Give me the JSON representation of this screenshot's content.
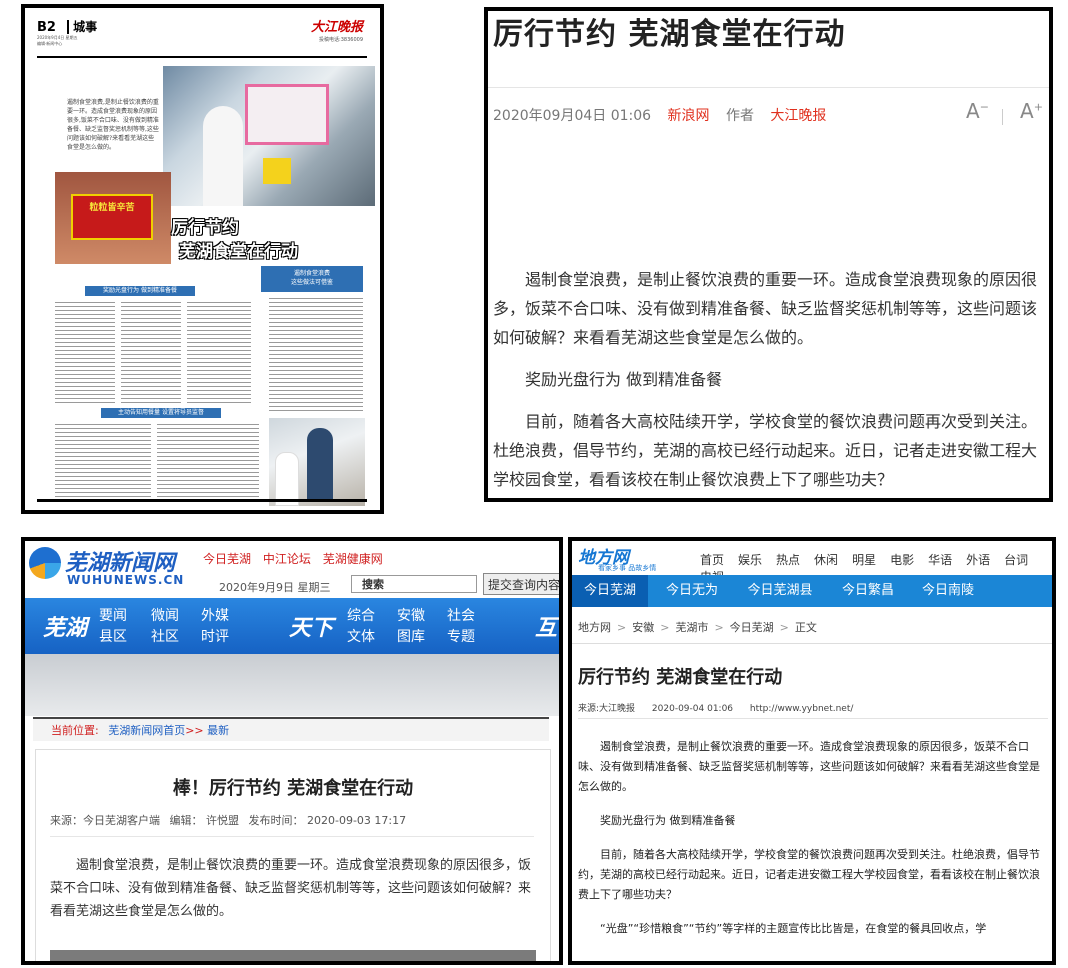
{
  "panel1": {
    "page_no": "B2",
    "section": "城事",
    "header_small": [
      "2020年9月4日  星期五",
      "编辑·新闻中心"
    ],
    "logo": "大江晚报",
    "hotline": "投稿电话:3836009",
    "intro": "遏制食堂浪费,是制止餐饮浪费的重要一环。造成食堂浪费现象的原因很多,饭菜不合口味、没有做到精准备餐、缺乏监督奖惩机制等等,这些问题该如何破解?来看看芜湖这些食堂是怎么做的。",
    "plate_text": "粒粒皆辛苦",
    "big_title": [
      "厉行节约",
      "芜湖食堂在行动"
    ],
    "side_box": [
      "遏制食堂浪费",
      "这些做法可借鉴"
    ],
    "sub1": "奖励光盘行为 做到精准备餐",
    "sub2": "主动告知用餐量 设置将导员监督"
  },
  "panel2": {
    "title": "厉行节约 芜湖食堂在行动",
    "date": "2020年09月04日 01:06",
    "source": "新浪网",
    "author_label": "作者",
    "author": "大江晚报",
    "font_smaller": "A",
    "font_larger": "A",
    "para1": "遏制食堂浪费，是制止餐饮浪费的重要一环。造成食堂浪费现象的原因很多，饭菜不合口味、没有做到精准备餐、缺乏监督奖惩机制等等，这些问题该如何破解？来看看芜湖这些食堂是怎么做的。",
    "para2": "奖励光盘行为 做到精准备餐",
    "para3": "目前，随着各大高校陆续开学，学校食堂的餐饮浪费问题再次受到关注。杜绝浪费，倡导节约，芜湖的高校已经行动起来。近日，记者走进安徽工程大学校园食堂，看看该校在制止餐饮浪费上下了哪些功夫？"
  },
  "panel3": {
    "logo": "芜湖新闻网",
    "logo_en": "WUHUNEWS.CN",
    "top_links": [
      "今日芜湖",
      "中江论坛",
      "芜湖健康网"
    ],
    "date": "2020年9月9日 星期三",
    "search_placeholder": "搜索",
    "search_button": "提交查询内容",
    "nav_group1": "芜湖",
    "nav_group2": "天下",
    "nav_group3": "互",
    "nav": [
      [
        "要闻",
        "县区"
      ],
      [
        "微闻",
        "社区"
      ],
      [
        "外媒",
        "时评"
      ],
      [
        "综合",
        "文体"
      ],
      [
        "安徽",
        "图库"
      ],
      [
        "社会",
        "专题"
      ]
    ],
    "crumb_label": "当前位置:",
    "crumb_home": "芜湖新闻网首页",
    "crumb_sep": ">>",
    "crumb_cur": "最新",
    "title": "棒！厉行节约 芜湖食堂在行动",
    "source": "来源：今日芜湖客户端",
    "editor": "编辑：  许悦盟",
    "time": "发布时间：  2020-09-03 17:17",
    "para1": "遏制食堂浪费，是制止餐饮浪费的重要一环。造成食堂浪费现象的原因很多，饭菜不合口味、没有做到精准备餐、缺乏监督奖惩机制等等，这些问题该如何破解？来看看芜湖这些食堂是怎么做的。"
  },
  "panel4": {
    "logo": "地方网",
    "logo_sub": "看家乡事 品故乡情",
    "links": [
      "首页",
      "娱乐",
      "热点",
      "休闲",
      "明星",
      "电影",
      "华语",
      "外语",
      "台词",
      "电视"
    ],
    "tabs": [
      "今日芜湖",
      "今日无为",
      "今日芜湖县",
      "今日繁昌",
      "今日南陵"
    ],
    "crumbs": [
      "地方网",
      "安徽",
      "芜湖市",
      "今日芜湖",
      "正文"
    ],
    "crumb_sep": ">",
    "title": "厉行节约 芜湖食堂在行动",
    "source": "来源:大江晚报",
    "time": "2020-09-04 01:06",
    "url": "http://www.yybnet.net/",
    "para1": "遏制食堂浪费，是制止餐饮浪费的重要一环。造成食堂浪费现象的原因很多，饭菜不合口味、没有做到精准备餐、缺乏监督奖惩机制等等，这些问题该如何破解？来看看芜湖这些食堂是怎么做的。",
    "para2": "奖励光盘行为  做到精准备餐",
    "para3": "目前，随着各大高校陆续开学，学校食堂的餐饮浪费问题再次受到关注。杜绝浪费，倡导节约，芜湖的高校已经行动起来。近日，记者走进安徽工程大学校园食堂，看看该校在制止餐饮浪费上下了哪些功夫？",
    "para4": "“光盘”“珍惜粮食”“节约”等字样的主题宣传比比皆是，在食堂的餐具回收点，学"
  }
}
